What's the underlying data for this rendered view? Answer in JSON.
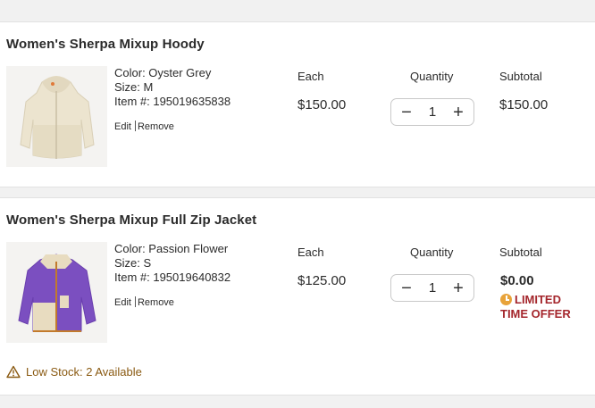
{
  "columns": {
    "each": "Each",
    "quantity": "Quantity",
    "subtotal": "Subtotal"
  },
  "items": [
    {
      "name": "Women's Sherpa Mixup Hoody",
      "color": "Color: Oyster Grey",
      "size": "Size: M",
      "item_no": "Item #: 195019635838",
      "edit": "Edit",
      "remove": "Remove",
      "each_price": "$150.00",
      "quantity": "1",
      "subtotal": "$150.00"
    },
    {
      "name": "Women's Sherpa Mixup Full Zip Jacket",
      "color": "Color: Passion Flower",
      "size": "Size: S",
      "item_no": "Item #: 195019640832",
      "edit": "Edit",
      "remove": "Remove",
      "each_price": "$125.00",
      "quantity": "1",
      "subtotal": "$0.00",
      "offer_line1": "LIMITED",
      "offer_line2": "TIME OFFER",
      "stock_warning": "Low Stock: 2 Available"
    }
  ],
  "qty_controls": {
    "minus": "−",
    "plus": "+"
  },
  "icons": {
    "minus": "minus-icon",
    "plus": "plus-icon",
    "clock": "clock-icon",
    "warning": "warning-triangle-icon"
  },
  "colors": {
    "offer_red": "#a4262c",
    "clock_orange": "#e8a33a",
    "stock_brown": "#8a5a12",
    "hoody_cream": "#e9e0c8",
    "jacket_purple": "#7b4fc0"
  }
}
